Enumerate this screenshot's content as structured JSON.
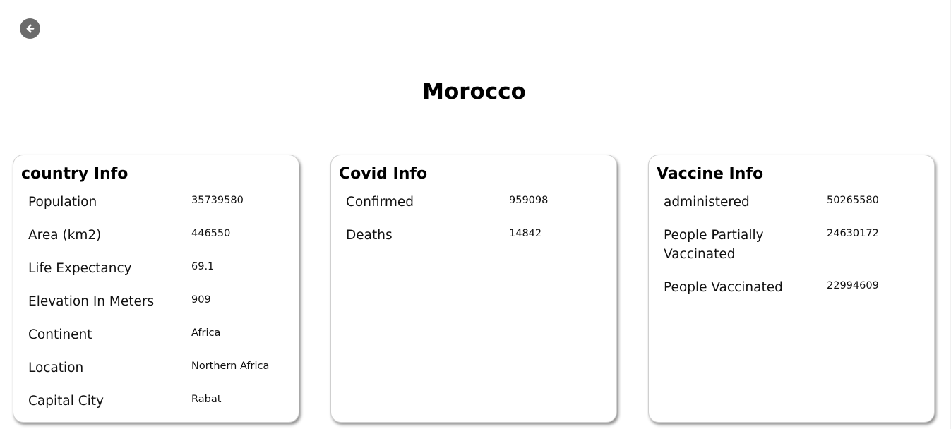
{
  "page": {
    "title": "Morocco",
    "back_icon": "arrow-left-icon"
  },
  "cards": {
    "country": {
      "title": "country Info",
      "rows": [
        {
          "label": "Population",
          "value": "35739580"
        },
        {
          "label": "Area (km2)",
          "value": "446550"
        },
        {
          "label": "Life Expectancy",
          "value": "69.1"
        },
        {
          "label": "Elevation In Meters",
          "value": "909"
        },
        {
          "label": "Continent",
          "value": "Africa"
        },
        {
          "label": "Location",
          "value": "Northern Africa"
        },
        {
          "label": "Capital City",
          "value": "Rabat"
        }
      ]
    },
    "covid": {
      "title": "Covid Info",
      "rows": [
        {
          "label": "Confirmed",
          "value": "959098"
        },
        {
          "label": "Deaths",
          "value": "14842"
        }
      ]
    },
    "vaccine": {
      "title": "Vaccine Info",
      "rows": [
        {
          "label": "administered",
          "value": "50265580"
        },
        {
          "label": "People Partially Vaccinated",
          "value": "24630172"
        },
        {
          "label": "People Vaccinated",
          "value": "22994609"
        }
      ]
    }
  },
  "colors": {
    "back_button_bg": "#6b6b6b",
    "card_border": "#cfcfcf"
  }
}
